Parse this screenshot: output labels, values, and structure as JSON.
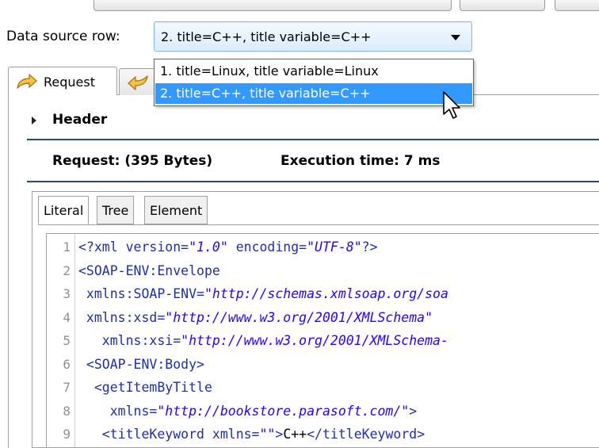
{
  "data_source": {
    "label": "Data source row:",
    "selected": "2. title=C++, title variable=C++",
    "options": [
      "1. title=Linux, title variable=Linux",
      "2. title=C++, title variable=C++"
    ]
  },
  "tabs": {
    "request": "Request"
  },
  "header_section": {
    "label": "Header"
  },
  "info": {
    "request": "Request:  (395 Bytes)",
    "execution": "Execution time: 7 ms"
  },
  "inner_tabs": [
    "Literal",
    "Tree",
    "Element"
  ],
  "code_lines": [
    {
      "n": "1",
      "parts": [
        [
          "tag",
          "<?xml "
        ],
        [
          "attr",
          "version="
        ],
        [
          "val",
          "\"1.0\""
        ],
        [
          "attr",
          " encoding="
        ],
        [
          "val",
          "\"UTF-8\""
        ],
        [
          "tag",
          "?>"
        ]
      ]
    },
    {
      "n": "2",
      "parts": [
        [
          "tag",
          "<SOAP-ENV:Envelope"
        ]
      ]
    },
    {
      "n": "3",
      "parts": [
        [
          "attr",
          " xmlns:SOAP-ENV="
        ],
        [
          "val",
          "\"http://schemas.xmlsoap.org/soa"
        ]
      ]
    },
    {
      "n": "4",
      "parts": [
        [
          "attr",
          " xmlns:xsd="
        ],
        [
          "val",
          "\"http://www.w3.org/2001/XMLSchema\""
        ]
      ]
    },
    {
      "n": "5",
      "parts": [
        [
          "attr",
          "   xmlns:xsi="
        ],
        [
          "val",
          "\"http://www.w3.org/2001/XMLSchema-"
        ]
      ]
    },
    {
      "n": "6",
      "parts": [
        [
          "tag",
          " <SOAP-ENV:Body>"
        ]
      ]
    },
    {
      "n": "7",
      "parts": [
        [
          "tag",
          "  <getItemByTitle"
        ]
      ]
    },
    {
      "n": "8",
      "parts": [
        [
          "attr",
          "    xmlns="
        ],
        [
          "val",
          "\"http://bookstore.parasoft.com/\""
        ],
        [
          "tag",
          ">"
        ]
      ]
    },
    {
      "n": "9",
      "parts": [
        [
          "tag",
          "   <titleKeyword "
        ],
        [
          "attr",
          "xmlns="
        ],
        [
          "val",
          "\"\""
        ],
        [
          "tag",
          ">"
        ],
        [
          "text",
          "C++"
        ],
        [
          "tag",
          "</titleKeyword>"
        ]
      ]
    }
  ]
}
